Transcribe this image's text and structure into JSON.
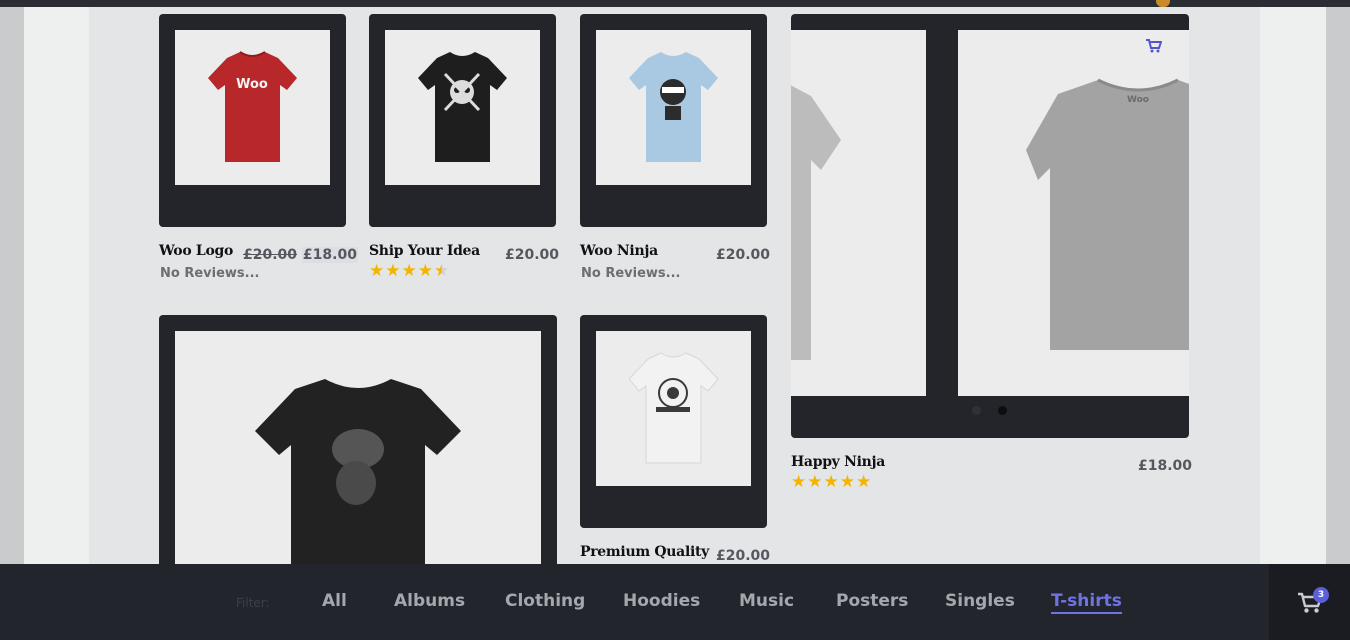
{
  "products": [
    {
      "title": "Woo Logo",
      "price_old": "£20.00",
      "price": "£18.00",
      "reviews": "No Reviews...",
      "shirt_color": "#b8282a",
      "print": "Woo"
    },
    {
      "title": "Ship Your Idea",
      "price": "£20.00",
      "rating": 4.5,
      "shirt_color": "#1e1e1e"
    },
    {
      "title": "Woo Ninja",
      "price": "£20.00",
      "reviews": "No Reviews...",
      "shirt_color": "#a9c8e2"
    },
    {
      "title": "Premium Quality",
      "price": "£20.00",
      "shirt_color": "#f2f2f2"
    },
    {
      "title": "Happy Ninja",
      "price": "£18.00",
      "rating": 5
    }
  ],
  "large_card": {
    "shirt_color": "#222222"
  },
  "slider": {
    "print": "Woo",
    "shirt_color": "#a3a3a3",
    "cart_icon": "cart-icon",
    "dots": 2,
    "active_dot": 1
  },
  "filter": {
    "label": "Filter:",
    "items": [
      "All",
      "Albums",
      "Clothing",
      "Hoodies",
      "Music",
      "Posters",
      "Singles",
      "T-shirts"
    ],
    "active": "T-shirts"
  },
  "cart": {
    "icon": "shopping-cart-icon",
    "count": "3"
  },
  "colors": {
    "accent": "#6f73e6",
    "star": "#f5b400",
    "card_frame": "#23252b",
    "bar": "#22252b"
  }
}
